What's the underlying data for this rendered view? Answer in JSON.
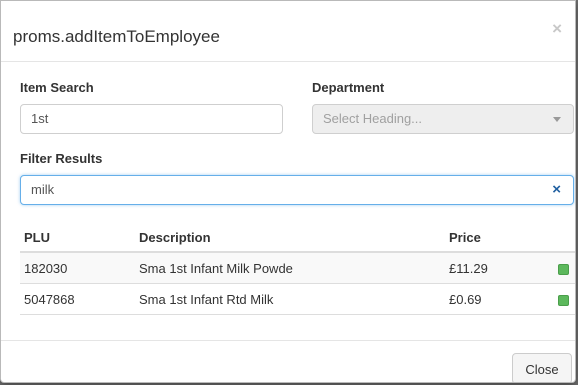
{
  "dialog": {
    "title": "proms.addItemToEmployee",
    "close_glyph": "×"
  },
  "item_search": {
    "label": "Item Search",
    "value": "1st"
  },
  "department": {
    "label": "Department",
    "placeholder": "Select Heading..."
  },
  "filter": {
    "label": "Filter Results",
    "value": "milk",
    "clear_glyph": "×"
  },
  "table": {
    "headers": [
      "PLU",
      "Description",
      "Price"
    ],
    "rows": [
      {
        "plu": "182030",
        "description": "Sma 1st Infant Milk Powde",
        "price": "£11.29",
        "status_color": "#5cb85c"
      },
      {
        "plu": "5047868",
        "description": "Sma 1st Infant Rtd Milk",
        "price": "£0.69",
        "status_color": "#5cb85c"
      }
    ]
  },
  "footer": {
    "close_label": "Close"
  }
}
